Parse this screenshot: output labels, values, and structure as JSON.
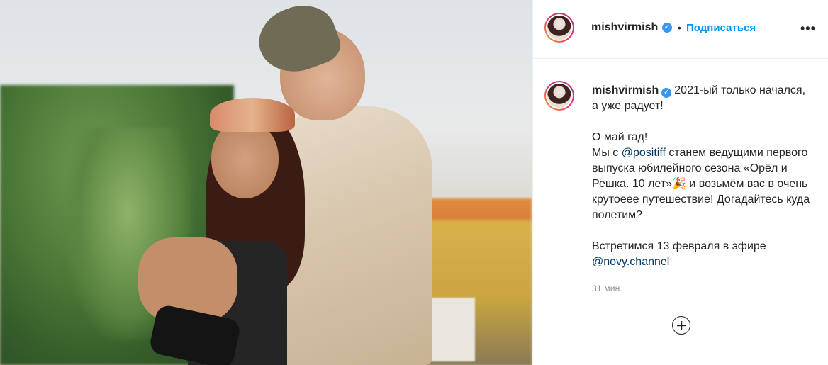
{
  "post": {
    "username": "mishvirmish",
    "follow_label": "Подписаться",
    "separator": "•",
    "more_label": "•••"
  },
  "caption": {
    "username": "mishvirmish",
    "line1": "2021-ый только начался, а уже радует!",
    "p2_a": "О май гад!",
    "p2_b_pre": "Мы с ",
    "p2_b_mention": "@positiff",
    "p2_b_post": " станем ведущими первого выпуска юбилейного сезона «Орёл и Решка. 10 лет»",
    "p2_emoji": "🎉",
    "p2_c": " и возьмём вас в очень крутоеее путешествие! Догадайтесь куда полетим?",
    "p3_a": "Встретимся 13 февраля в эфире",
    "p3_mention": "@novy.channel"
  },
  "timestamp": "31 мин.",
  "icons": {
    "verified": "verified-badge-icon",
    "add": "plus-circle-icon"
  },
  "colors": {
    "follow": "#0095f6",
    "mention": "#00376b",
    "verified": "#3897f0"
  }
}
